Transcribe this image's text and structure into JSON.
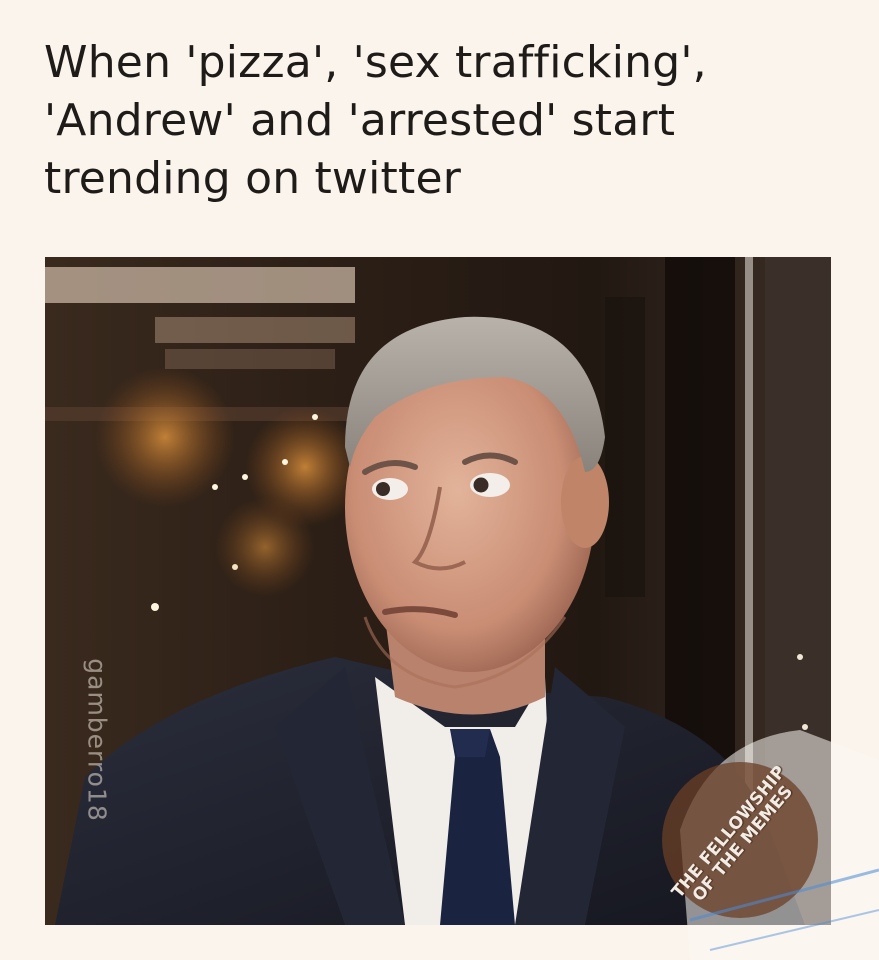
{
  "caption": {
    "line1": "When 'pizza', 'sex trafficking',",
    "line2": "'Andrew' and 'arrested' start",
    "line3": "trending on twitter"
  },
  "watermark": "gamberro18",
  "stamp": {
    "line1": "THE FELLOWSHIP",
    "line2": "OF THE MEMES"
  },
  "colors": {
    "background": "#fbf4ec",
    "caption_text": "#1e1b19",
    "suit": "#1d1f2b",
    "tie": "#1a2340"
  }
}
